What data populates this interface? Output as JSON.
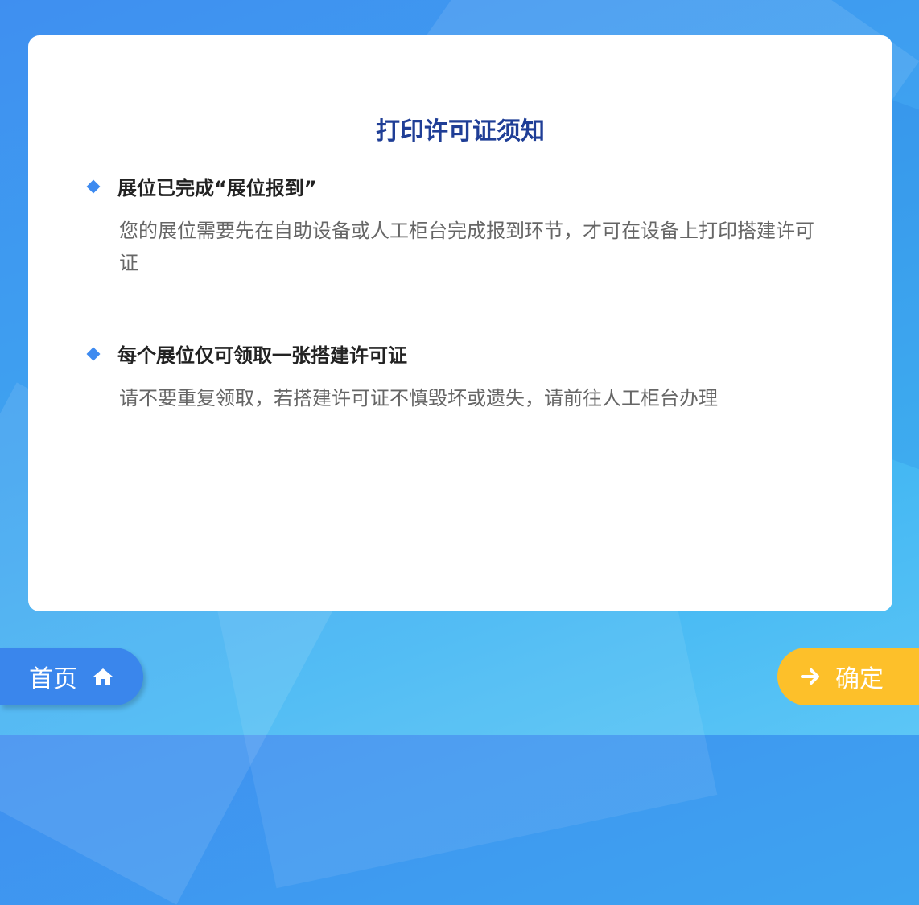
{
  "notice": {
    "title": "打印许可证须知",
    "items": [
      {
        "title": "展位已完成“展位报到”",
        "description": "您的展位需要先在自助设备或人工柜台完成报到环节，才可在设备上打印搭建许可证"
      },
      {
        "title": "每个展位仅可领取一张搭建许可证",
        "description": "请不要重复领取，若搭建许可证不慎毁坏或遗失，请前往人工柜台办理"
      }
    ]
  },
  "footer": {
    "home_label": "首页",
    "home_icon": "home-icon",
    "confirm_label": "确定",
    "confirm_icon": "arrow-right-icon"
  },
  "colors": {
    "title": "#1f3e96",
    "bullet": "#3d8af0",
    "home_button": "#3a86ec",
    "confirm_button": "#fdc02a"
  }
}
